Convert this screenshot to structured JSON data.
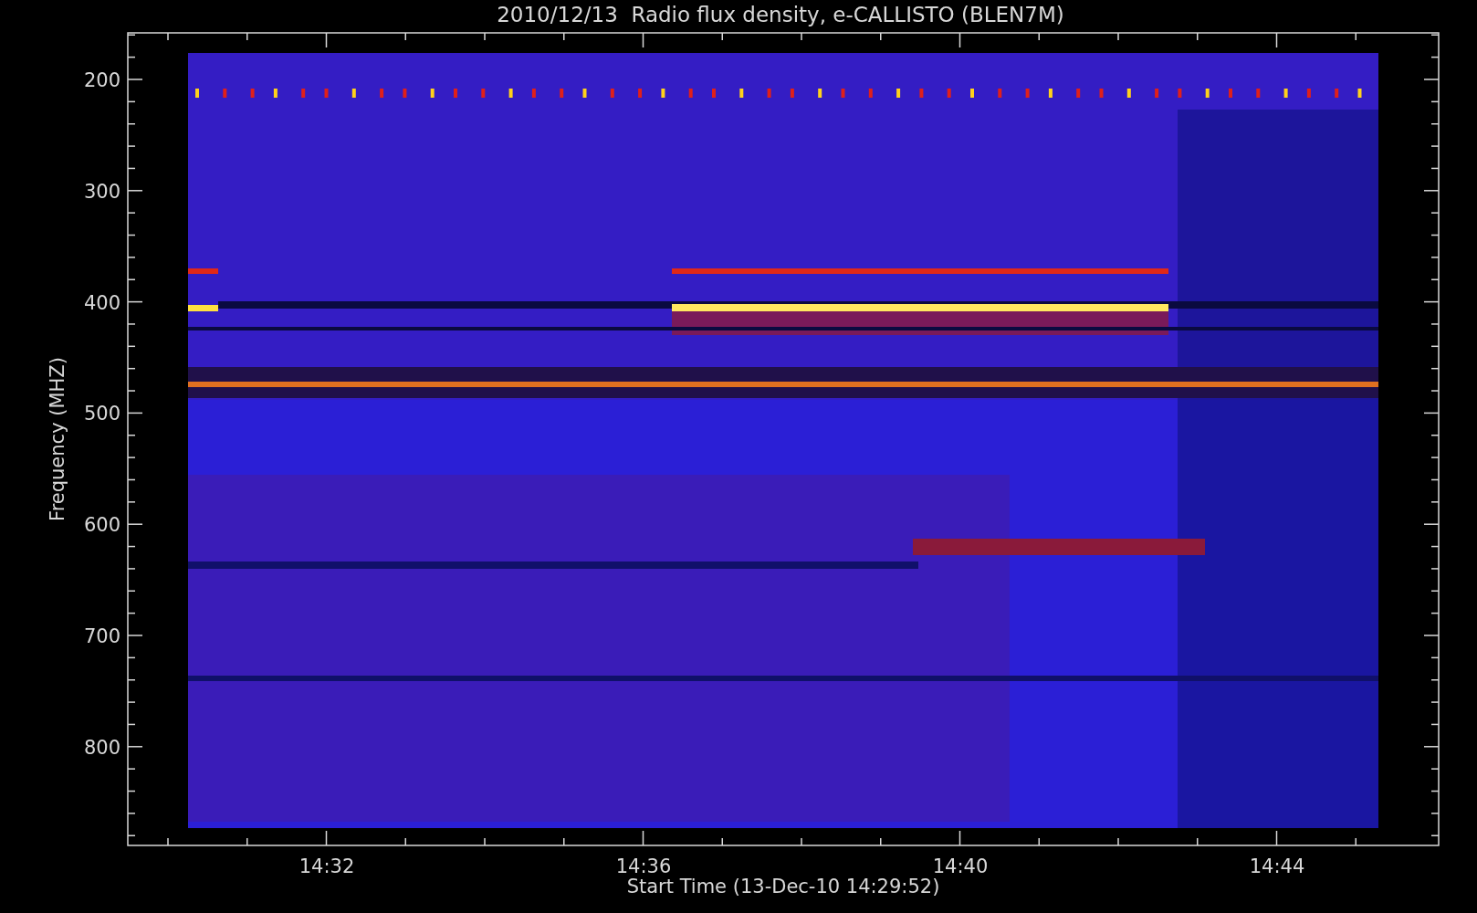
{
  "title": "2010/12/13  Radio flux density, e-CALLISTO (BLEN7M)",
  "y_axis": {
    "label": "Frequency (MHZ)",
    "ticks": [
      "200",
      "300",
      "400",
      "500",
      "600",
      "700",
      "800"
    ]
  },
  "x_axis": {
    "label": "Start Time (13-Dec-10 14:29:52)",
    "ticks": [
      "14:32",
      "14:36",
      "14:40",
      "14:44"
    ]
  }
}
